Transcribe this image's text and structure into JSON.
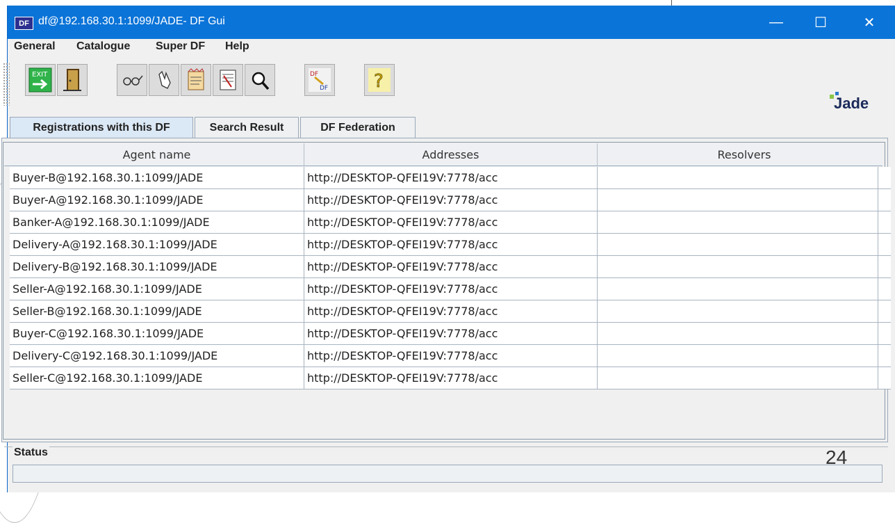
{
  "window": {
    "app_icon": "DF",
    "title": "df@192.168.30.1:1099/JADE- DF Gui",
    "controls": {
      "minimize": "—",
      "maximize": "☐",
      "close": "✕"
    }
  },
  "menu": [
    "General",
    "Catalogue",
    "Super DF",
    "Help"
  ],
  "toolbar": {
    "buttons": [
      {
        "name": "exit-icon",
        "label": "EXIT"
      },
      {
        "name": "door-icon",
        "label": ""
      },
      {
        "name": "glasses-icon",
        "label": ""
      },
      {
        "name": "hand-icon",
        "label": ""
      },
      {
        "name": "document-icon",
        "label": ""
      },
      {
        "name": "list-icon",
        "label": ""
      },
      {
        "name": "search-icon",
        "label": ""
      },
      {
        "name": "df-federate-icon",
        "label": "DF"
      },
      {
        "name": "help-icon",
        "label": "?"
      }
    ],
    "logo": "Jade"
  },
  "tabs": [
    "Registrations with this DF",
    "Search Result",
    "DF Federation"
  ],
  "table": {
    "columns": [
      "Agent name",
      "Addresses",
      "Resolvers"
    ],
    "rows": [
      [
        "Buyer-B@192.168.30.1:1099/JADE",
        "http://DESKTOP-QFEI19V:7778/acc",
        ""
      ],
      [
        "Buyer-A@192.168.30.1:1099/JADE",
        "http://DESKTOP-QFEI19V:7778/acc",
        ""
      ],
      [
        "Banker-A@192.168.30.1:1099/JADE",
        "http://DESKTOP-QFEI19V:7778/acc",
        ""
      ],
      [
        "Delivery-A@192.168.30.1:1099/JADE",
        "http://DESKTOP-QFEI19V:7778/acc",
        ""
      ],
      [
        "Delivery-B@192.168.30.1:1099/JADE",
        "http://DESKTOP-QFEI19V:7778/acc",
        ""
      ],
      [
        "Seller-A@192.168.30.1:1099/JADE",
        "http://DESKTOP-QFEI19V:7778/acc",
        ""
      ],
      [
        "Seller-B@192.168.30.1:1099/JADE",
        "http://DESKTOP-QFEI19V:7778/acc",
        ""
      ],
      [
        "Buyer-C@192.168.30.1:1099/JADE",
        "http://DESKTOP-QFEI19V:7778/acc",
        ""
      ],
      [
        "Delivery-C@192.168.30.1:1099/JADE",
        "http://DESKTOP-QFEI19V:7778/acc",
        ""
      ],
      [
        "Seller-C@192.168.30.1:1099/JADE",
        "http://DESKTOP-QFEI19V:7778/acc",
        ""
      ]
    ]
  },
  "status": {
    "label": "Status",
    "value": ""
  },
  "page_number": "24"
}
